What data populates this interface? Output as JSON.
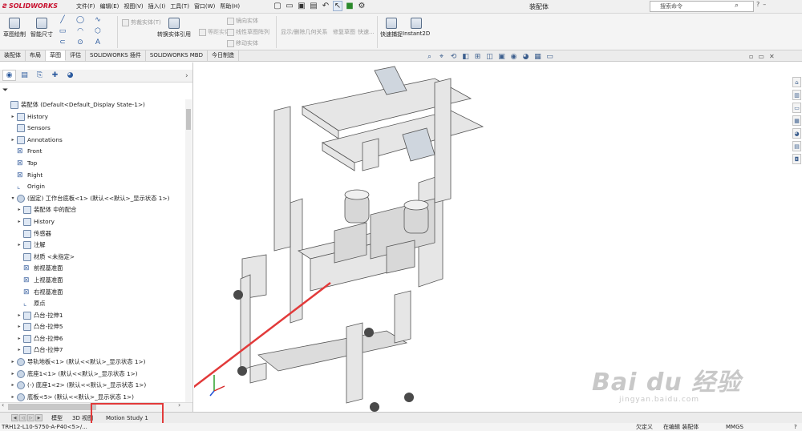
{
  "app": {
    "logo": "SOLIDWORKS",
    "menu": [
      "文件(F)",
      "编辑(E)",
      "视图(V)",
      "插入(I)",
      "工具(T)",
      "窗口(W)",
      "帮助(H)"
    ],
    "document_title": "装配体",
    "search_placeholder": "搜索命令",
    "qa_icons": [
      "new-icon",
      "open-icon",
      "save-icon",
      "print-icon",
      "undo-icon",
      "select-icon",
      "rebuild-icon",
      "options-icon"
    ]
  },
  "command_manager": {
    "big_buttons": [
      "草图绘制",
      "智能尺寸",
      "转换实体引用",
      "快速捕捉",
      "Instant2D"
    ],
    "greyed": [
      "剪裁实体(T)",
      "等距实体",
      "镜向实体",
      "线性草图阵列",
      "移动实体",
      "显示/删除几何关系",
      "修复草图",
      "快速..."
    ],
    "tabs": [
      "装配体",
      "布局",
      "草图",
      "评估",
      "SOLIDWORKS 插件",
      "SOLIDWORKS MBD",
      "今日制造"
    ],
    "active_tab": "草图"
  },
  "feature_tree": {
    "rows": [
      {
        "label": "装配体  (Default<Default_Display State-1>)",
        "indent": 0,
        "exp": "",
        "icon": "assembly-icon"
      },
      {
        "label": "History",
        "indent": 1,
        "exp": "▸",
        "icon": "history-icon"
      },
      {
        "label": "Sensors",
        "indent": 1,
        "exp": "",
        "icon": "sensors-icon"
      },
      {
        "label": "Annotations",
        "indent": 1,
        "exp": "▸",
        "icon": "annotations-icon"
      },
      {
        "label": "Front",
        "indent": 1,
        "exp": "",
        "icon": "plane-icon"
      },
      {
        "label": "Top",
        "indent": 1,
        "exp": "",
        "icon": "plane-icon"
      },
      {
        "label": "Right",
        "indent": 1,
        "exp": "",
        "icon": "plane-icon"
      },
      {
        "label": "Origin",
        "indent": 1,
        "exp": "",
        "icon": "origin-icon"
      },
      {
        "label": "(固定) 工作台底板<1> (默认<<默认>_显示状态 1>)",
        "indent": 1,
        "exp": "▾",
        "icon": "part-icon"
      },
      {
        "label": "装配体 中的配合",
        "indent": 2,
        "exp": "▸",
        "icon": "mates-icon"
      },
      {
        "label": "History",
        "indent": 2,
        "exp": "▸",
        "icon": "history-icon"
      },
      {
        "label": "传感器",
        "indent": 2,
        "exp": "",
        "icon": "sensors-icon"
      },
      {
        "label": "注解",
        "indent": 2,
        "exp": "▸",
        "icon": "annotations-icon"
      },
      {
        "label": "材质 <未指定>",
        "indent": 2,
        "exp": "",
        "icon": "material-icon"
      },
      {
        "label": "前视基准面",
        "indent": 2,
        "exp": "",
        "icon": "plane-icon"
      },
      {
        "label": "上视基准面",
        "indent": 2,
        "exp": "",
        "icon": "plane-icon"
      },
      {
        "label": "右视基准面",
        "indent": 2,
        "exp": "",
        "icon": "plane-icon"
      },
      {
        "label": "原点",
        "indent": 2,
        "exp": "",
        "icon": "origin-icon"
      },
      {
        "label": "凸台-拉伸1",
        "indent": 2,
        "exp": "▸",
        "icon": "extrude-icon"
      },
      {
        "label": "凸台-拉伸5",
        "indent": 2,
        "exp": "▸",
        "icon": "extrude-icon"
      },
      {
        "label": "凸台-拉伸6",
        "indent": 2,
        "exp": "▸",
        "icon": "extrude-icon"
      },
      {
        "label": "凸台-拉伸7",
        "indent": 2,
        "exp": "▸",
        "icon": "extrude-icon"
      },
      {
        "label": "导轨地板<1> (默认<<默认>_显示状态 1>)",
        "indent": 1,
        "exp": "▸",
        "icon": "part-icon"
      },
      {
        "label": "底座1<1> (默认<<默认>_显示状态 1>)",
        "indent": 1,
        "exp": "▸",
        "icon": "part-icon"
      },
      {
        "label": "(-) 底座1<2> (默认<<默认>_显示状态 1>)",
        "indent": 1,
        "exp": "▸",
        "icon": "part-icon"
      },
      {
        "label": "底板<5> (默认<<默认>_显示状态 1>)",
        "indent": 1,
        "exp": "▸",
        "icon": "part-icon"
      }
    ]
  },
  "bottom_tabs": [
    "模型",
    "3D 视图",
    "Motion Study 1"
  ],
  "status": {
    "left": "TRH12-L10-S750-A-P40<5>/...",
    "undefined": "欠定义",
    "editing": "在编辑 装配体",
    "units": "MMGS"
  },
  "colors": {
    "highlight": "#e23a3a",
    "arrow": "#e23a3a",
    "brand": "#c8102e"
  },
  "watermark": {
    "main": "Bai du 经验",
    "sub": "jingyan.baidu.com"
  }
}
